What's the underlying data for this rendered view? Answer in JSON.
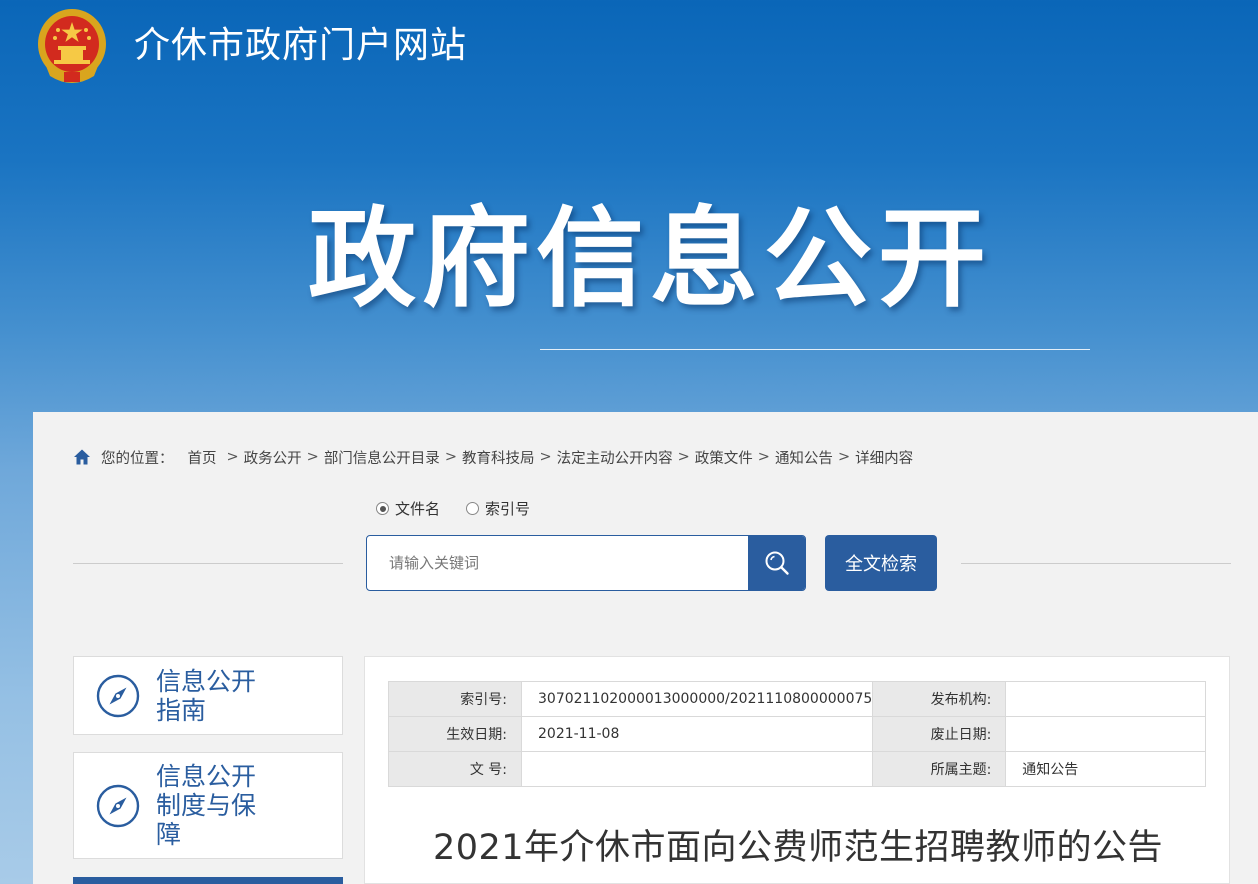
{
  "header": {
    "site_title": "介休市政府门户网站",
    "emblem_icon": "national-emblem-icon"
  },
  "banner": {
    "title": "政府信息公开"
  },
  "breadcrumb": {
    "label": "您的位置：",
    "items": [
      "首页",
      "政务公开",
      "部门信息公开目录",
      "教育科技局",
      "法定主动公开内容",
      "政策文件",
      "通知公告",
      "详细内容"
    ],
    "separator": ">"
  },
  "search": {
    "options": [
      "文件名",
      "索引号"
    ],
    "selected": "文件名",
    "placeholder": "请输入关键词",
    "fulltext_label": "全文检索"
  },
  "sidebar": {
    "items": [
      {
        "label": "信息公开指南",
        "icon": "compass-icon"
      },
      {
        "label": "信息公开制度与保障",
        "icon": "compass-icon"
      }
    ]
  },
  "document": {
    "meta": {
      "index_label": "索引号:",
      "index_value": "307021102000013000000/2021110800000075",
      "publisher_label": "发布机构:",
      "publisher_value": "",
      "effective_label": "生效日期:",
      "effective_value": "2021-11-08",
      "expire_label": "废止日期:",
      "expire_value": "",
      "docno_label": "文 号:",
      "docno_value": "",
      "topic_label": "所属主题:",
      "topic_value": "通知公告"
    },
    "title": "2021年介休市面向公费师范生招聘教师的公告"
  },
  "colors": {
    "accent": "#2a5d9f",
    "banner_top": "#0a66b8",
    "panel_bg": "#f2f2f2"
  }
}
